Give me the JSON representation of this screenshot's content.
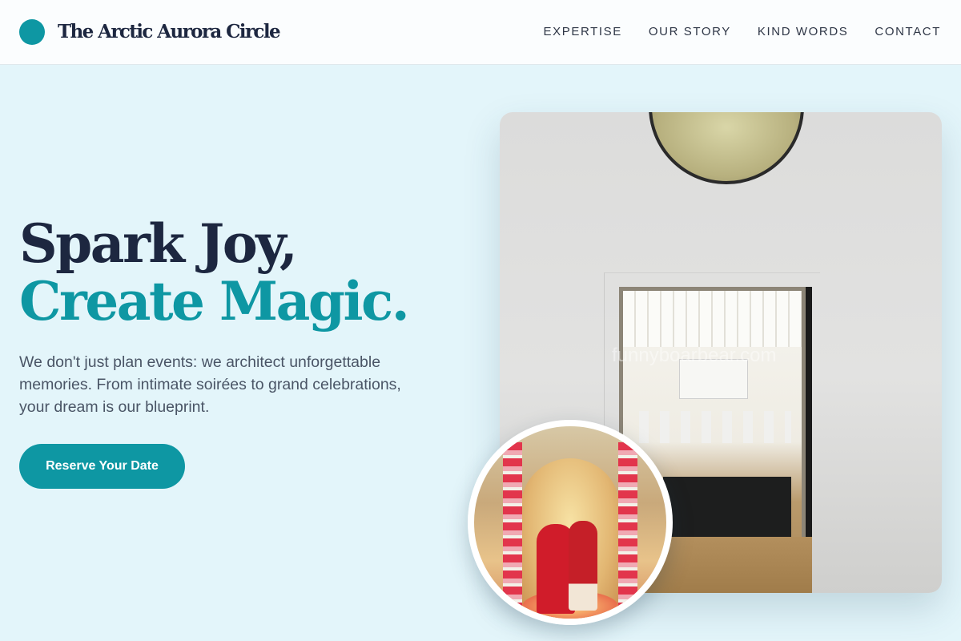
{
  "header": {
    "brand": "The Arctic Aurora Circle",
    "nav": [
      "EXPERTISE",
      "OUR STORY",
      "KIND WORDS",
      "CONTACT"
    ]
  },
  "hero": {
    "title_line1": "Spark Joy,",
    "title_line2": "Create Magic.",
    "description": "We don't just plan events: we architect unforgettable memories. From intimate soirées to grand celebrations, your dream is our blueprint.",
    "cta_label": "Reserve Your Date"
  },
  "images": {
    "venue_watermark": "funnyboarbear.com"
  },
  "colors": {
    "accent": "#0e97a3",
    "dark_text": "#1d2740",
    "background": "#e3f5fa"
  }
}
